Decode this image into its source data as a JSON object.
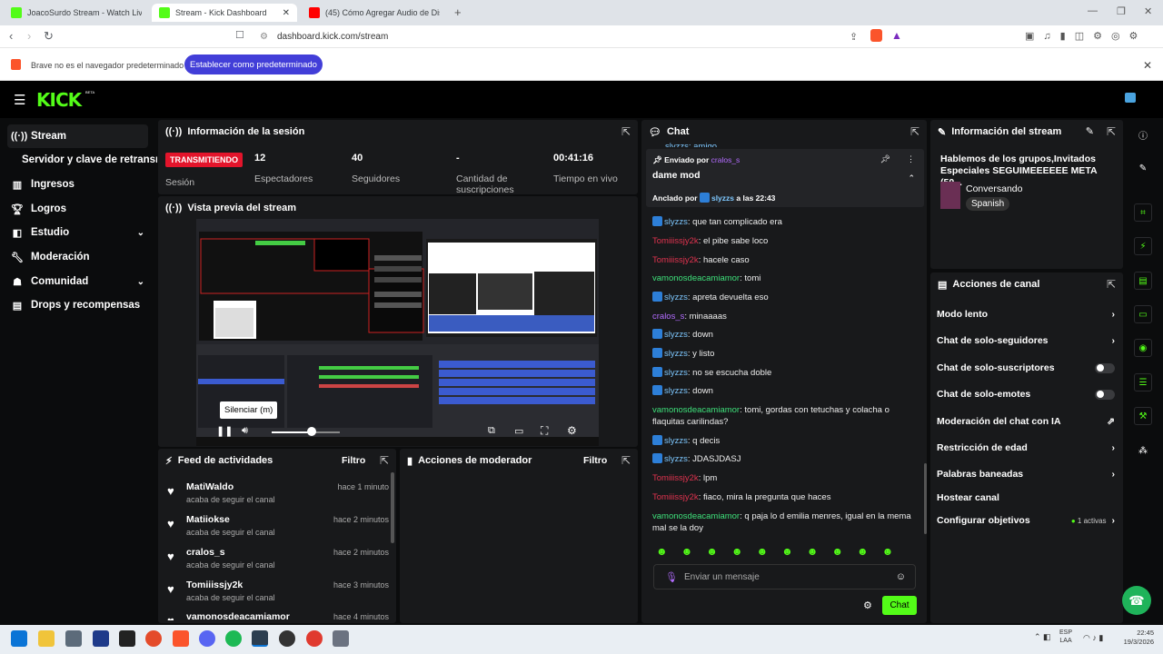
{
  "browser": {
    "tabs": [
      {
        "label": "JoacoSurdo Stream - Watch Live on K",
        "icon": "kick"
      },
      {
        "label": "Stream - Kick Dashboard",
        "icon": "kick"
      },
      {
        "label": "(45) Cómo Agregar Audio de Discord",
        "icon": "youtube"
      }
    ],
    "url": "dashboard.kick.com/stream",
    "infobar": {
      "text": "Brave no es el navegador predeterminado",
      "button": "Establecer como predeterminado"
    }
  },
  "logo": "KICK",
  "logo_badge": "BETA",
  "sidebar": [
    {
      "label": "Stream",
      "icon": "broadcast-icon"
    },
    {
      "label": "Servidor y clave de retransmisión"
    },
    {
      "label": "Ingresos",
      "icon": "chart-icon"
    },
    {
      "label": "Logros",
      "icon": "trophy-icon"
    },
    {
      "label": "Estudio",
      "icon": "studio-icon"
    },
    {
      "label": "Moderación",
      "icon": "wrench-icon"
    },
    {
      "label": "Comunidad",
      "icon": "community-icon"
    },
    {
      "label": "Drops y recompensas",
      "icon": "drops-icon"
    }
  ],
  "session": {
    "title": "Información de la sesión",
    "status": "TRANSMITIENDO",
    "status_label": "Sesión",
    "stats": [
      {
        "value": "12",
        "label": "Espectadores"
      },
      {
        "value": "40",
        "label": "Seguidores"
      },
      {
        "value": "-",
        "label": "Cantidad de suscripciones"
      },
      {
        "value": "00:41:16",
        "label": "Tiempo en vivo"
      }
    ]
  },
  "preview": {
    "title": "Vista previa del stream",
    "tooltip": "Silenciar (m)",
    "progress": 0.58
  },
  "feed": {
    "title": "Feed de actividades",
    "filter": "Filtro",
    "items": [
      {
        "user": "MatiWaldo",
        "action": "acaba de seguir el canal",
        "time": "hace 1 minuto"
      },
      {
        "user": "Matiiokse",
        "action": "acaba de seguir el canal",
        "time": "hace 2 minutos"
      },
      {
        "user": "cralos_s",
        "action": "acaba de seguir el canal",
        "time": "hace 2 minutos"
      },
      {
        "user": "Tomiiissjy2k",
        "action": "acaba de seguir el canal",
        "time": "hace 3 minutos"
      },
      {
        "user": "vamonosdeacamiamor",
        "action": "",
        "time": "hace 4 minutos"
      }
    ]
  },
  "modactions": {
    "title": "Acciones de moderador",
    "filter": "Filtro"
  },
  "chat": {
    "title": "Chat",
    "top_partial": "slyzzs: amigo",
    "pinned": {
      "sent_by": "Enviado por",
      "sent_user": "cralos_s",
      "text": "dame mod",
      "pinned_by": "Anclado por",
      "pinned_user": "slyzzs",
      "pinned_time": "a las 22:43"
    },
    "messages": [
      {
        "user": "slyzzs",
        "text": "que tan complicado era",
        "color": "#7ec8ff",
        "badge": true
      },
      {
        "user": "Tomiiissjy2k",
        "text": "el pibe sabe loco",
        "color": "#e0334f",
        "badge": false
      },
      {
        "user": "Tomiiissjy2k",
        "text": "hacele caso",
        "color": "#e0334f",
        "badge": false
      },
      {
        "user": "vamonosdeacamiamor",
        "text": "tomi",
        "color": "#3ee07a",
        "badge": false
      },
      {
        "user": "slyzzs",
        "text": "apreta devuelta eso",
        "color": "#7ec8ff",
        "badge": true
      },
      {
        "user": "cralos_s",
        "text": "minaaaas",
        "color": "#b36cff",
        "badge": false
      },
      {
        "user": "slyzzs",
        "text": "down",
        "color": "#7ec8ff",
        "badge": true
      },
      {
        "user": "slyzzs",
        "text": "y listo",
        "color": "#7ec8ff",
        "badge": true
      },
      {
        "user": "slyzzs",
        "text": "no se escucha doble",
        "color": "#7ec8ff",
        "badge": true
      },
      {
        "user": "slyzzs",
        "text": "down",
        "color": "#7ec8ff",
        "badge": true
      },
      {
        "user": "vamonosdeacamiamor",
        "text": "tomi, gordas con tetuchas y colacha o flaquitas carilindas?",
        "color": "#3ee07a",
        "badge": false
      },
      {
        "user": "slyzzs",
        "text": "q decis",
        "color": "#7ec8ff",
        "badge": true
      },
      {
        "user": "slyzzs",
        "text": "JDASJDASJ",
        "color": "#7ec8ff",
        "badge": true
      },
      {
        "user": "Tomiiissjy2k",
        "text": "lpm",
        "color": "#e0334f",
        "badge": false
      },
      {
        "user": "Tomiiissjy2k",
        "text": "fiaco, mira la pregunta que haces",
        "color": "#e0334f",
        "badge": false
      },
      {
        "user": "vamonosdeacamiamor",
        "text": "q paja lo d emilia menres, igual en la mema mal se la doy",
        "color": "#3ee07a",
        "badge": false
      }
    ],
    "placeholder": "Enviar un mensaje",
    "send": "Chat"
  },
  "streaminfo": {
    "title": "Información del stream",
    "stream_title": "Hablemos de los grupos,Invitados Especiales SEGUIMEEEEEE META (50...",
    "category": "Conversando",
    "language": "Spanish"
  },
  "channel": {
    "title": "Acciones de canal",
    "actions": [
      {
        "label": "Modo lento",
        "control": "chevron"
      },
      {
        "label": "Chat de solo-seguidores",
        "control": "chevron"
      },
      {
        "label": "Chat de solo-suscriptores",
        "control": "toggle"
      },
      {
        "label": "Chat de solo-emotes",
        "control": "toggle"
      },
      {
        "label": "Moderación del chat con IA",
        "control": "external"
      },
      {
        "label": "Restricción de edad",
        "control": "chevron"
      },
      {
        "label": "Palabras baneadas",
        "control": "chevron"
      },
      {
        "label": "Hostear canal",
        "control": "none"
      },
      {
        "label": "Configurar objetivos",
        "control": "chevron",
        "extra": "1 activas"
      }
    ]
  },
  "taskbar": {
    "lang": "ESP",
    "lang2": "LAA",
    "time": "22:45",
    "date": "19/3/2026"
  },
  "colors": {
    "accent": "#53fc18",
    "panel": "#18191b",
    "live": "#e3142b"
  }
}
